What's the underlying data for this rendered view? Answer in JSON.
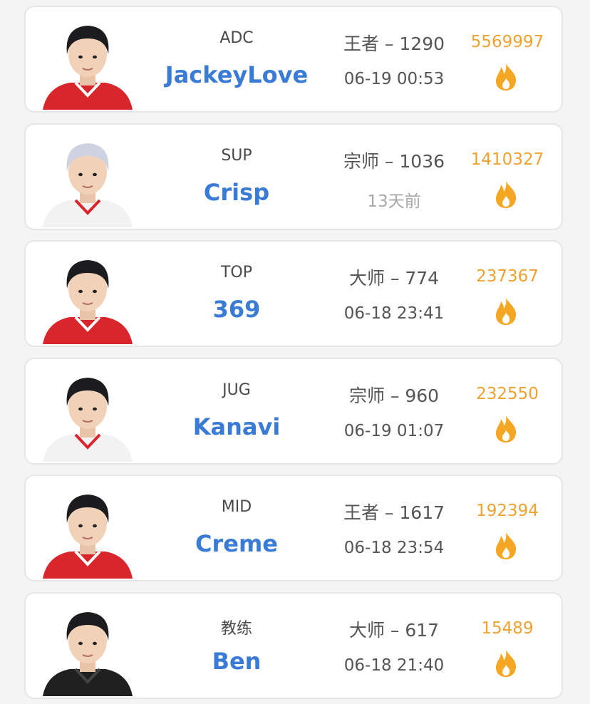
{
  "players": [
    {
      "role": "ADC",
      "name": "JackeyLove",
      "rank": "王者 – 1290",
      "time": "06-19 00:53",
      "heat": "5569997",
      "hair": "dark",
      "shirt": "red",
      "time_muted": false
    },
    {
      "role": "SUP",
      "name": "Crisp",
      "rank": "宗师 – 1036",
      "time": "13天前",
      "heat": "1410327",
      "hair": "silver",
      "shirt": "white",
      "time_muted": true
    },
    {
      "role": "TOP",
      "name": "369",
      "rank": "大师 – 774",
      "time": "06-18 23:41",
      "heat": "237367",
      "hair": "dark",
      "shirt": "red",
      "time_muted": false
    },
    {
      "role": "JUG",
      "name": "Kanavi",
      "rank": "宗师 – 960",
      "time": "06-19 01:07",
      "heat": "232550",
      "hair": "dark",
      "shirt": "white",
      "time_muted": false
    },
    {
      "role": "MID",
      "name": "Creme",
      "rank": "王者 – 1617",
      "time": "06-18 23:54",
      "heat": "192394",
      "hair": "dark",
      "shirt": "red",
      "time_muted": false
    },
    {
      "role": "教练",
      "name": "Ben",
      "rank": "大师 – 617",
      "time": "06-18 21:40",
      "heat": "15489",
      "hair": "dark",
      "shirt": "black",
      "time_muted": false
    }
  ],
  "colors": {
    "name": "#3a7bd5",
    "heat": "#f0a22e",
    "fire": "#f5a623",
    "card_border": "#e6e6e8"
  },
  "icons": {
    "fire": "fire-icon",
    "avatar": "player-avatar"
  }
}
